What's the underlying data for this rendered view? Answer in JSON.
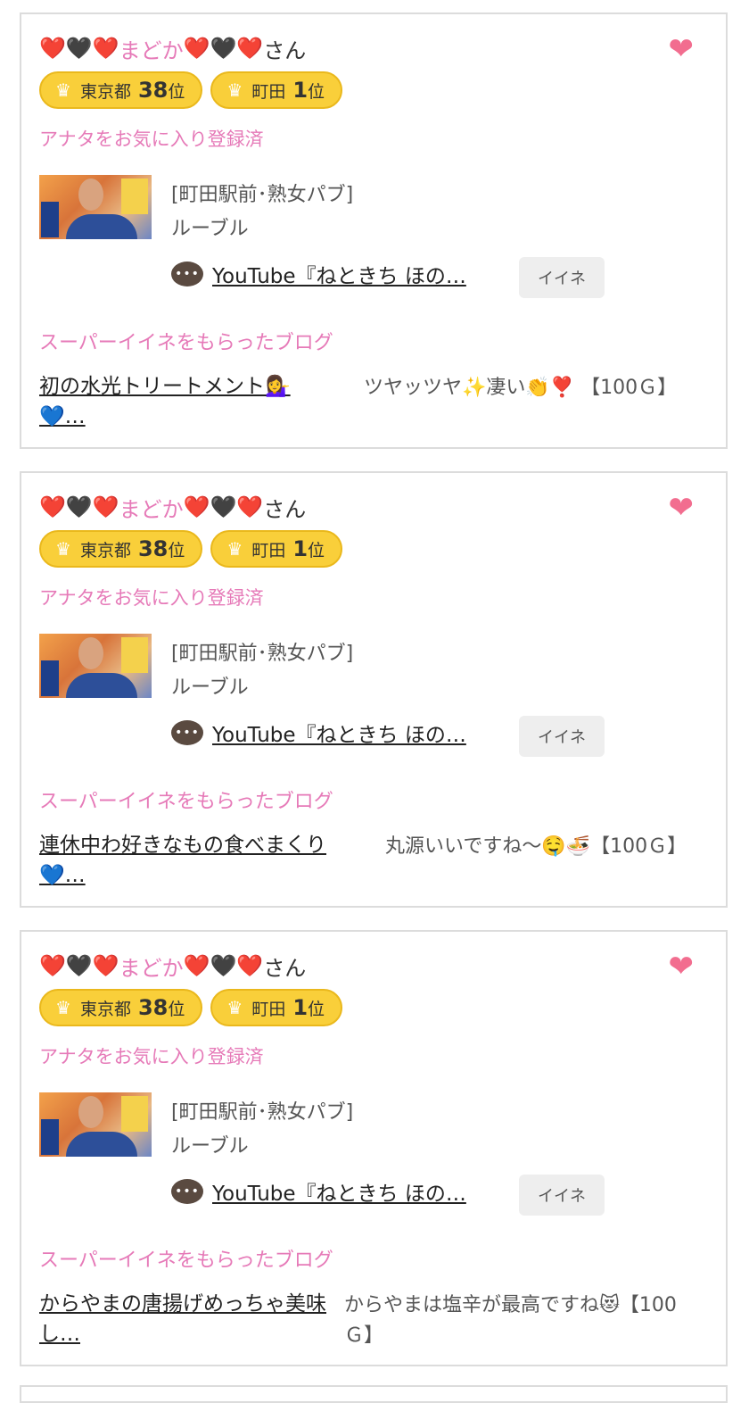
{
  "colors": {
    "accent_pink": "#e67ab8",
    "heart": "#f26d8f",
    "rank_badge": "#f9cf3a"
  },
  "cards": [
    {
      "user_name": {
        "prefix": "❤️🖤❤️",
        "name": "まどか",
        "suffix_hearts": "❤️🖤❤️",
        "honorific": "さん"
      },
      "favorite_icon": "❤",
      "ranks": [
        {
          "region": "東京都",
          "num": "38",
          "suffix": "位"
        },
        {
          "region": "町田",
          "num": "1",
          "suffix": "位"
        }
      ],
      "fav_status": "アナタをお気に入り登録済",
      "shop_line1": "[町田駅前･熟女パブ]",
      "shop_line2": "ルーブル",
      "comment_icon": "•••",
      "comment": "YouTube『ねときち ほの…",
      "iine_label": "イイネ",
      "super_heading": "スーパーイイネをもらったブログ",
      "blog_title": "初の水光トリートメント💁‍♀️💙…",
      "blog_comment": "ツヤッツヤ✨凄い👏❣️ 【100Ｇ】"
    },
    {
      "user_name": {
        "prefix": "❤️🖤❤️",
        "name": "まどか",
        "suffix_hearts": "❤️🖤❤️",
        "honorific": "さん"
      },
      "favorite_icon": "❤",
      "ranks": [
        {
          "region": "東京都",
          "num": "38",
          "suffix": "位"
        },
        {
          "region": "町田",
          "num": "1",
          "suffix": "位"
        }
      ],
      "fav_status": "アナタをお気に入り登録済",
      "shop_line1": "[町田駅前･熟女パブ]",
      "shop_line2": "ルーブル",
      "comment_icon": "•••",
      "comment": "YouTube『ねときち ほの…",
      "iine_label": "イイネ",
      "super_heading": "スーパーイイネをもらったブログ",
      "blog_title": "連休中わ好きなもの食べまくり💙…",
      "blog_comment": "丸源いいですね〜🤤🍜【100Ｇ】"
    },
    {
      "user_name": {
        "prefix": "❤️🖤❤️",
        "name": "まどか",
        "suffix_hearts": "❤️🖤❤️",
        "honorific": "さん"
      },
      "favorite_icon": "❤",
      "ranks": [
        {
          "region": "東京都",
          "num": "38",
          "suffix": "位"
        },
        {
          "region": "町田",
          "num": "1",
          "suffix": "位"
        }
      ],
      "fav_status": "アナタをお気に入り登録済",
      "shop_line1": "[町田駅前･熟女パブ]",
      "shop_line2": "ルーブル",
      "comment_icon": "•••",
      "comment": "YouTube『ねときち ほの…",
      "iine_label": "イイネ",
      "super_heading": "スーパーイイネをもらったブログ",
      "blog_title": "からやまの唐揚げめっちゃ美味し…",
      "blog_comment": "からやまは塩辛が最高ですね😻【100Ｇ】"
    }
  ]
}
